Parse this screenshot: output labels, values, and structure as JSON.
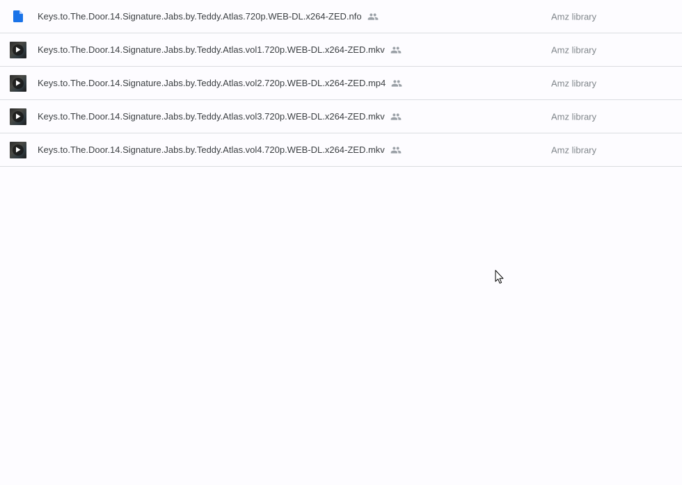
{
  "files": [
    {
      "name": "Keys.to.The.Door.14.Signature.Jabs.by.Teddy.Atlas.720p.WEB-DL.x264-ZED.nfo",
      "type_icon": "doc-icon",
      "shared": true,
      "location": "Amz library"
    },
    {
      "name": "Keys.to.The.Door.14.Signature.Jabs.by.Teddy.Atlas.vol1.720p.WEB-DL.x264-ZED.mkv",
      "type_icon": "video-thumbnail-icon",
      "shared": true,
      "location": "Amz library"
    },
    {
      "name": "Keys.to.The.Door.14.Signature.Jabs.by.Teddy.Atlas.vol2.720p.WEB-DL.x264-ZED.mp4",
      "type_icon": "video-thumbnail-icon",
      "shared": true,
      "location": "Amz library"
    },
    {
      "name": "Keys.to.The.Door.14.Signature.Jabs.by.Teddy.Atlas.vol3.720p.WEB-DL.x264-ZED.mkv",
      "type_icon": "video-thumbnail-icon",
      "shared": true,
      "location": "Amz library"
    },
    {
      "name": "Keys.to.The.Door.14.Signature.Jabs.by.Teddy.Atlas.vol4.720p.WEB-DL.x264-ZED.mkv",
      "type_icon": "video-thumbnail-icon",
      "shared": true,
      "location": "Amz library"
    }
  ],
  "colors": {
    "doc_icon": "#1a73e8",
    "shared_icon": "#9aa0a6",
    "text": "#3c4043",
    "secondary_text": "#80868b",
    "divider": "#dadce0",
    "background": "#fdfcff"
  }
}
